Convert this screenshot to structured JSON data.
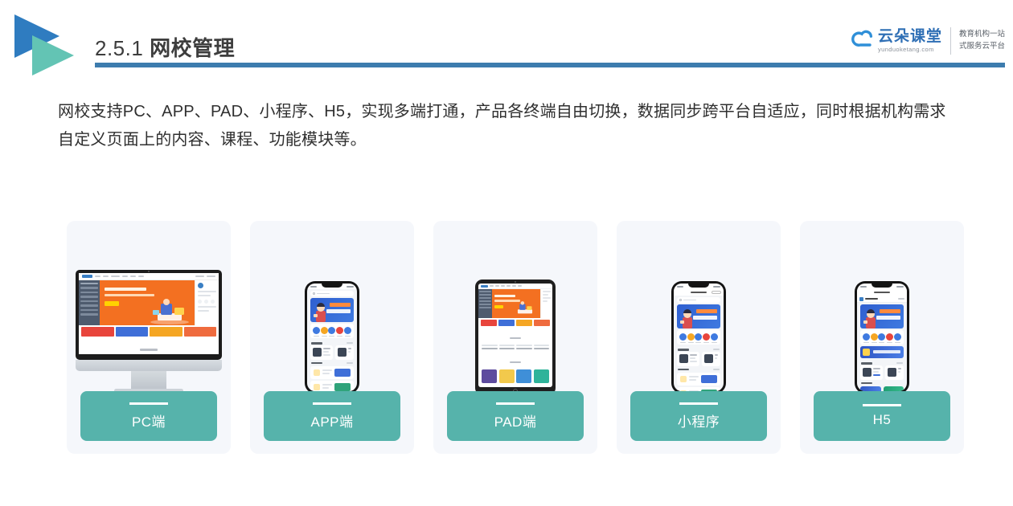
{
  "header": {
    "section_number": "2.5.1",
    "section_title": "网校管理",
    "accent_color": "#3d7cae",
    "logo_colors": {
      "primary": "#2f7cc0",
      "secondary": "#63c4b4"
    }
  },
  "brand": {
    "name_cn": "云朵课堂",
    "name_en": "yunduoketang.com",
    "tagline_line1": "教育机构一站",
    "tagline_line2": "式服务云平台",
    "color": "#2f6fb5"
  },
  "body": {
    "paragraph": "网校支持PC、APP、PAD、小程序、H5，实现多端打通，产品各终端自由切换，数据同步跨平台自适应，同时根据机构需求自定义页面上的内容、课程、功能模块等。"
  },
  "cards": {
    "label_color": "#56b3ab",
    "background_color": "#f5f7fb",
    "items": [
      {
        "label": "PC端",
        "device": "desktop-monitor"
      },
      {
        "label": "APP端",
        "device": "smartphone"
      },
      {
        "label": "PAD端",
        "device": "tablet"
      },
      {
        "label": "小程序",
        "device": "smartphone-miniprogram"
      },
      {
        "label": "H5",
        "device": "smartphone-h5"
      }
    ]
  }
}
